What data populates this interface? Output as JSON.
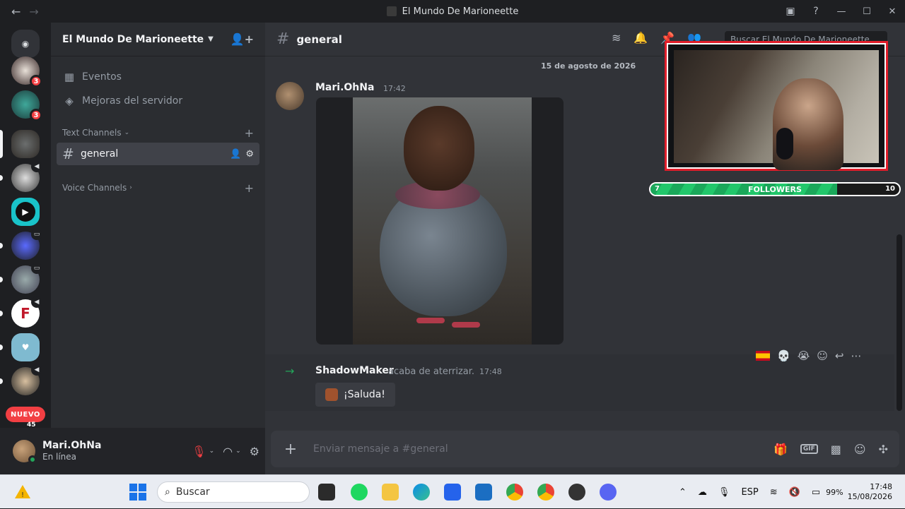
{
  "window": {
    "title": "El Mundo De Marioneette"
  },
  "server": {
    "name": "El Mundo De Marioneette"
  },
  "sidebar": {
    "items": [
      {
        "label": "Eventos",
        "icon": "calendar-icon"
      },
      {
        "label": "Mejoras del servidor",
        "icon": "boost-icon"
      }
    ],
    "text_category": "Text Channels",
    "voice_category": "Voice Channels",
    "active_channel": "general"
  },
  "rail": {
    "badges": [
      "3",
      "3"
    ],
    "nuevo_label": "NUEVO",
    "nuevo_count": "45"
  },
  "user": {
    "name": "Mari.OhNa",
    "status": "En línea"
  },
  "channel_header": {
    "name": "general",
    "search_placeholder": "Buscar El Mundo De Marioneette"
  },
  "messages": {
    "date_divider": "15 de agosto de 2026",
    "first": {
      "author": "Mari.OhNa",
      "time": "17:42"
    },
    "system": {
      "author": "ShadowMaker",
      "action": "acaba de aterrizar.",
      "time": "17:48",
      "wave_label": "¡Saluda!"
    }
  },
  "composer": {
    "placeholder": "Enviar mensaje a #general",
    "gif_label": "GIF"
  },
  "overlay": {
    "followers_label": "FOLLOWERS",
    "min": "7",
    "max": "10",
    "progress": 0.75
  },
  "taskbar": {
    "search_placeholder": "Buscar",
    "lang": "ESP",
    "battery": "99%",
    "time": "17:48",
    "date": "15/08/2026"
  },
  "colors": {
    "accent": "#5865f2",
    "danger": "#f23f43",
    "online": "#23a55a",
    "background": "#313338"
  }
}
